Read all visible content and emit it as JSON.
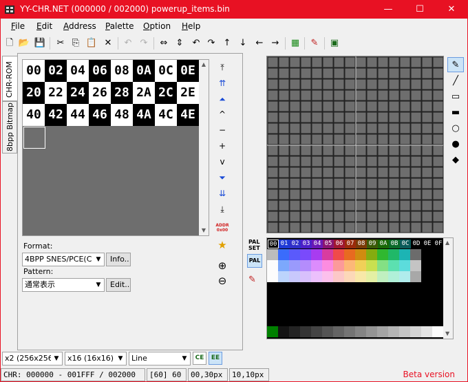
{
  "window": {
    "title": "YY-CHR.NET (000000 / 002000) powerup_items.bin",
    "minimize": "—",
    "maximize": "☐",
    "close": "✕"
  },
  "menu": [
    "File",
    "Edit",
    "Address",
    "Palette",
    "Option",
    "Help"
  ],
  "menu_access_keys": [
    "F",
    "E",
    "A",
    "P",
    "O",
    "H"
  ],
  "toolbar": {
    "new": "🗋",
    "open": "📂",
    "save": "💾",
    "cut": "✂",
    "copy": "⎘",
    "paste": "📋",
    "delete": "✕",
    "undo": "↶",
    "redo": "↷",
    "flip_h": "⇔",
    "flip_v": "⇕",
    "rotate_l": "↶",
    "rotate_r": "↷",
    "shift_up": "↑",
    "shift_down": "↓",
    "shift_left": "←",
    "shift_right": "→",
    "palette_tool": "▦",
    "edit_tool": "✎",
    "save_palette": "▣"
  },
  "tabs": {
    "chr_rom": "CHR-ROM",
    "bitmap": "8bpp Bitmap"
  },
  "tiles": {
    "row1": [
      "00",
      "02",
      "04",
      "06",
      "08",
      "0A",
      "0C",
      "0E"
    ],
    "row2": [
      "20",
      "22",
      "24",
      "26",
      "28",
      "2A",
      "2C",
      "2E"
    ],
    "row3": [
      "40",
      "42",
      "44",
      "46",
      "48",
      "4A",
      "4C",
      "4E"
    ]
  },
  "nav": {
    "top": "⤒",
    "page_up": "⇈",
    "up_fast": "⏶",
    "up": "^",
    "minus": "−",
    "plus": "+",
    "down": "v",
    "down_fast": "⏷",
    "page_down": "⇊",
    "bottom": "⤓",
    "addr_line1": "ADDR",
    "addr_line2": "0x00",
    "favorite": "★",
    "zoom_in": "⊕",
    "zoom_out": "⊖"
  },
  "format": {
    "label": "Format:",
    "value": "4BPP SNES/PCE(C",
    "info_button": "Info.."
  },
  "pattern": {
    "label": "Pattern:",
    "value": "通常表示",
    "edit_button": "Edit.."
  },
  "palette": {
    "label_line1": "PAL",
    "label_line2": "SET",
    "pal_button": "PAL",
    "indices": [
      "00",
      "01",
      "02",
      "03",
      "04",
      "05",
      "06",
      "07",
      "08",
      "09",
      "0A",
      "0B",
      "0C",
      "0D",
      "0E",
      "0F"
    ],
    "row0": [
      "#000000",
      "#1e3ad6",
      "#2f2fc8",
      "#4b1fc8",
      "#6a18b4",
      "#8a1470",
      "#a01830",
      "#9a2a0a",
      "#7a3a06",
      "#3a5a06",
      "#186806",
      "#0a6a2a",
      "#0a5a5a",
      "#000000",
      "#000000",
      "#000000"
    ],
    "row1": [
      "#bcbcbc",
      "#3a6cfc",
      "#5a5afc",
      "#7a4afc",
      "#a83cf0",
      "#d83ca0",
      "#f04a4a",
      "#e86a20",
      "#d08c10",
      "#84ac10",
      "#30b830",
      "#20b868",
      "#1cb4b4",
      "#6c6c6c",
      "#000000",
      "#000000"
    ],
    "row2": [
      "#fcfcfc",
      "#7ca8fc",
      "#9a9afc",
      "#b48cfc",
      "#dc8cfc",
      "#fc8ce0",
      "#fc9a9a",
      "#fcb878",
      "#f0d058",
      "#c8e050",
      "#84e084",
      "#5ce0b0",
      "#5cdcdc",
      "#c4c4c4",
      "#000000",
      "#000000"
    ],
    "row3": [
      "#fcfcfc",
      "#bcd4fc",
      "#c8c8fc",
      "#d8c0fc",
      "#ecc0fc",
      "#fcc0ec",
      "#fcc8c8",
      "#fcd8b8",
      "#f8e8a8",
      "#e4f0a4",
      "#c0f0c0",
      "#b0f0d8",
      "#b0ecec",
      "#a8a8a8",
      "#000000",
      "#000000"
    ],
    "row7": [
      "#008000",
      "#141414",
      "#242424",
      "#343434",
      "#444444",
      "#545454",
      "#646464",
      "#747474",
      "#848484",
      "#949494",
      "#a4a4a4",
      "#b4b4b4",
      "#c4c4c4",
      "#d4d4d4",
      "#e4e4e4",
      "#fcfcfc"
    ]
  },
  "tools": {
    "pen": "✎",
    "line": "╱",
    "rect": "▭",
    "rect_fill": "▬",
    "circle": "○",
    "circle_fill": "●",
    "fill": "◆"
  },
  "bottom": {
    "zoom": "x2 (256x256)",
    "grid": "x16 (16x16)",
    "line_mode": "Line",
    "ce_button": "CE",
    "ee_button": "EE"
  },
  "status": {
    "range": "CHR: 000000 - 001FFF / 002000",
    "sel": "[60] 60",
    "pos": "00,30px",
    "size": "10,10px",
    "beta": "Beta version"
  }
}
